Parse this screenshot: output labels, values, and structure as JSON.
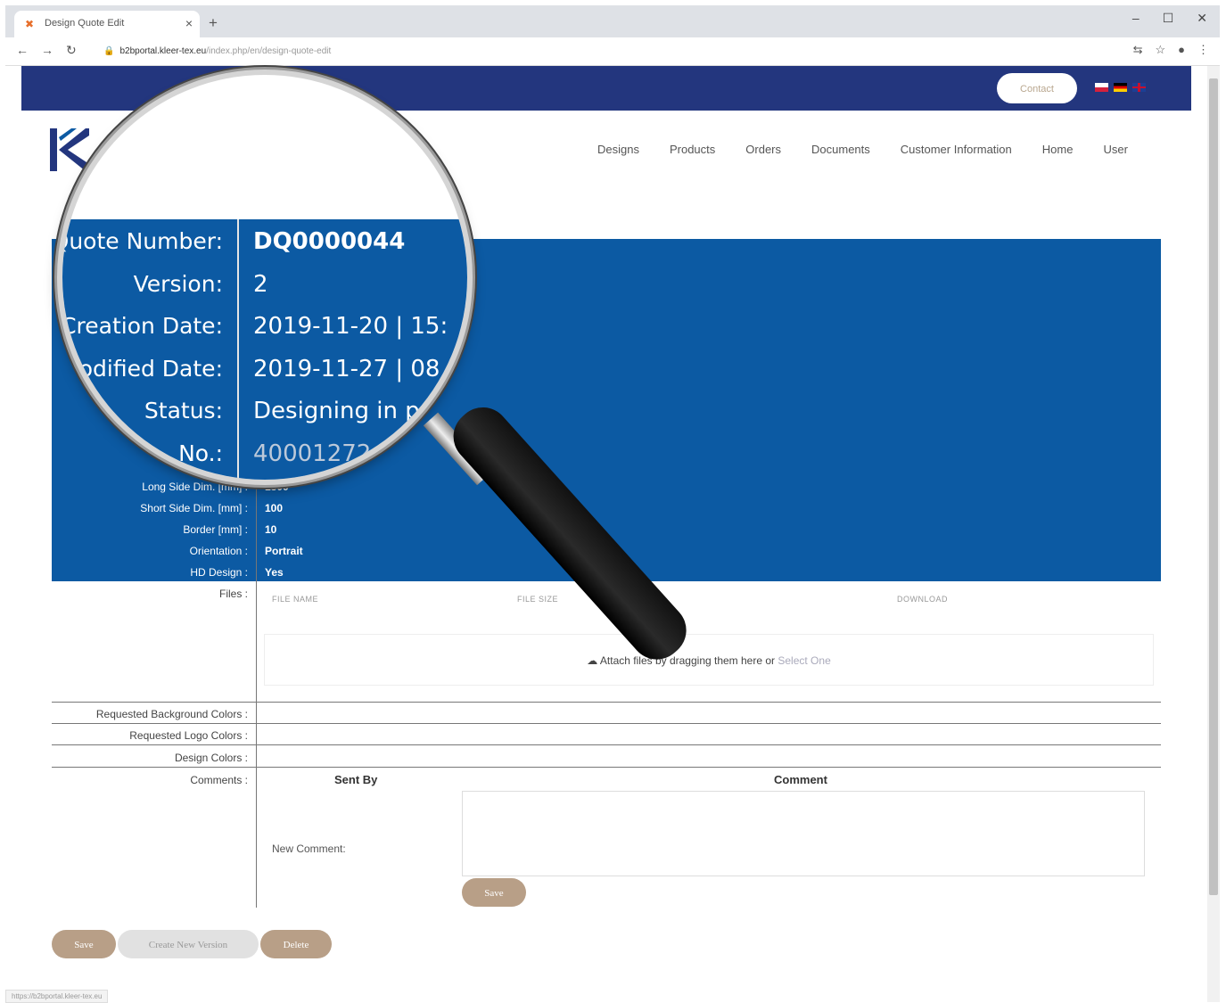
{
  "browser": {
    "tab_title": "Design Quote Edit",
    "tab_close": "×",
    "new_tab": "+",
    "url_host": "b2bportal.kleer-tex.eu",
    "url_path": "/index.php/en/design-quote-edit",
    "status_url": "https://b2bportal.kleer-tex.eu"
  },
  "header": {
    "contact_label": "Contact",
    "nav": [
      "Designs",
      "Products",
      "Orders",
      "Documents",
      "Customer Information",
      "Home",
      "User"
    ]
  },
  "details": {
    "rows": [
      {
        "label": "Long Side Dim. [mm] :",
        "value": "1800"
      },
      {
        "label": "Short Side Dim. [mm] :",
        "value": "100"
      },
      {
        "label": "Border [mm] :",
        "value": "10"
      },
      {
        "label": "Orientation :",
        "value": "Portrait"
      },
      {
        "label": "HD Design :",
        "value": "Yes"
      }
    ]
  },
  "magnified": {
    "rows": [
      {
        "label": "Quote Number:",
        "value": "DQ0000044"
      },
      {
        "label": "Version:",
        "value": "2"
      },
      {
        "label": "Creation Date:",
        "value": "2019-11-20 | 15:"
      },
      {
        "label": "Modified Date:",
        "value": "2019-11-27 | 08"
      },
      {
        "label": "Status:",
        "value": "Designing in p"
      },
      {
        "label": "No.:",
        "value": "40001272"
      }
    ]
  },
  "files": {
    "label": "Files :",
    "col_name": "FILE NAME",
    "col_size": "FILE SIZE",
    "col_download": "DOWNLOAD",
    "drop_prefix": "Attach files by dragging them here or",
    "drop_link": "Select One"
  },
  "colors": {
    "bg_label": "Requested Background Colors :",
    "logo_label": "Requested Logo Colors :",
    "design_label": "Design Colors :"
  },
  "comments": {
    "label": "Comments :",
    "sent_by": "Sent By",
    "comment": "Comment",
    "new_comment": "New Comment:",
    "save": "Save"
  },
  "actions": {
    "save": "Save",
    "create_new_version": "Create New Version",
    "delete": "Delete"
  },
  "theme": {
    "topbar": "#23367e",
    "panel": "#0c5aa3",
    "button_tan": "#b89f87"
  }
}
